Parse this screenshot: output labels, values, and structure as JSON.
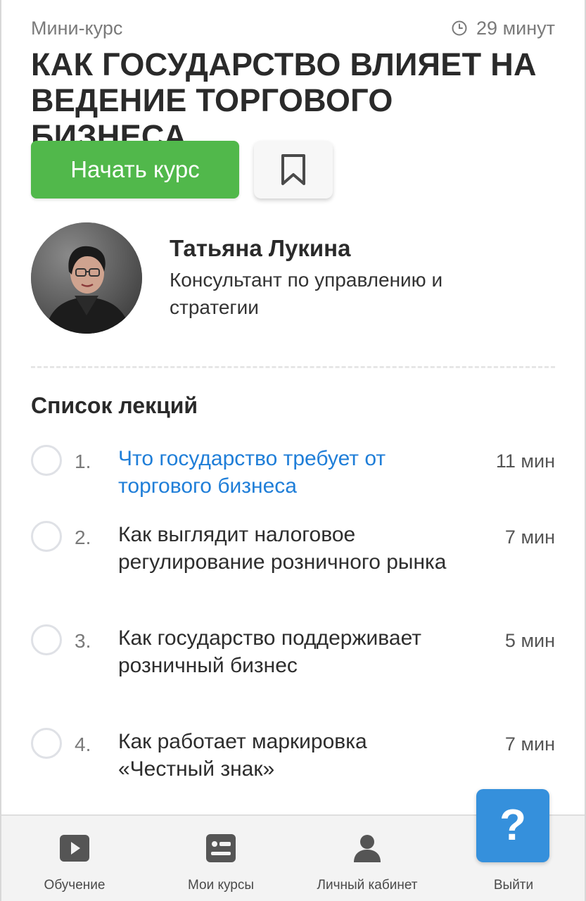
{
  "header": {
    "course_type": "Мини-курс",
    "duration": "29 минут",
    "title": "КАК ГОСУДАРСТВО ВЛИЯЕТ НА ВЕДЕНИЕ ТОРГОВОГО БИЗНЕСА"
  },
  "actions": {
    "start_label": "Начать курс",
    "bookmark_icon": "bookmark-icon"
  },
  "author": {
    "name": "Татьяна Лукина",
    "role": "Консультант по управлению и стратегии"
  },
  "lectures": {
    "heading": "Список лекций",
    "items": [
      {
        "number": "1.",
        "title": "Что государство требует от торгового бизнеса",
        "duration": "11 мин",
        "active": true
      },
      {
        "number": "2.",
        "title": "Как выглядит налоговое регулирование розничного рынка",
        "duration": "7 мин",
        "active": false
      },
      {
        "number": "3.",
        "title": "Как государство поддерживает розничный бизнес",
        "duration": "5 мин",
        "active": false
      },
      {
        "number": "4.",
        "title": "Как работает маркировка «Честный знак»",
        "duration": "7 мин",
        "active": false
      }
    ]
  },
  "nav": {
    "items": [
      {
        "label": "Обучение",
        "icon": "play-icon"
      },
      {
        "label": "Мои курсы",
        "icon": "id-card-icon"
      },
      {
        "label": "Личный кабинет",
        "icon": "user-icon"
      },
      {
        "label": "Выйти",
        "icon": "logout-icon"
      }
    ]
  },
  "help": {
    "label": "?"
  },
  "colors": {
    "accent_green": "#51b84b",
    "link_blue": "#1f7ed8",
    "help_blue": "#3590dc"
  }
}
